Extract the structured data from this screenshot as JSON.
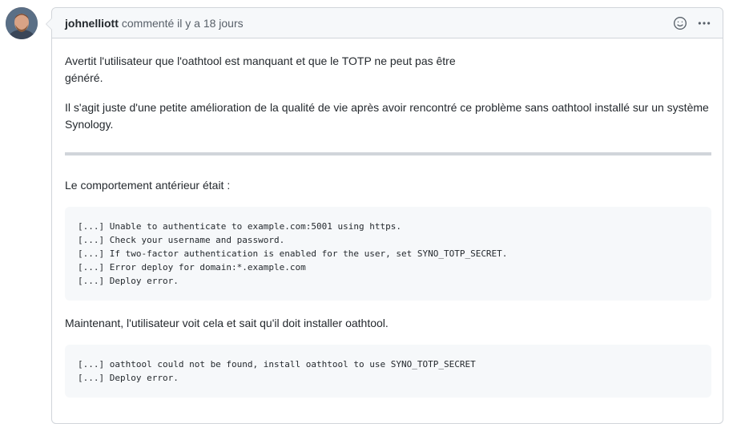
{
  "comment": {
    "author": "johnelliott",
    "meta": "commenté il y a 18 jours",
    "header_icons": [
      "smiley-icon",
      "kebab-menu-icon"
    ],
    "body": {
      "paragraph_1": "Avertit l'utilisateur que l'oathtool est manquant et que le TOTP ne peut pas être généré.",
      "paragraph_2": "Il s'agit juste d'une petite amélioration de la qualité de vie après avoir rencontré ce problème sans oathtool installé sur un système Synology.",
      "paragraph_3": "Le comportement antérieur était :",
      "code_1": "[...] Unable to authenticate to example.com:5001 using https.\n[...] Check your username and password.\n[...] If two-factor authentication is enabled for the user, set SYNO_TOTP_SECRET.\n[...] Error deploy for domain:*.example.com\n[...] Deploy error.",
      "paragraph_4": "Maintenant, l'utilisateur voit cela et sait qu'il doit installer oathtool.",
      "code_2": "[...] oathtool could not be found, install oathtool to use SYNO_TOTP_SECRET\n[...] Deploy error."
    }
  },
  "colors": {
    "border": "#d1d5da",
    "header_bg": "#f6f8fa",
    "text": "#24292e",
    "muted": "#586069"
  }
}
